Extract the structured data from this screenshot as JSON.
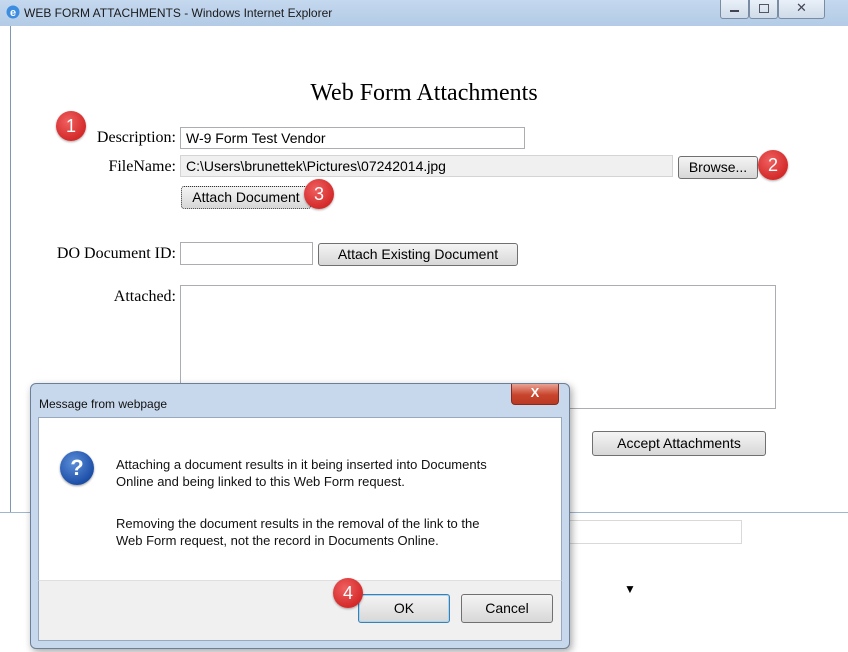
{
  "window": {
    "title": "WEB FORM ATTACHMENTS - Windows Internet Explorer"
  },
  "form": {
    "heading": "Web Form Attachments",
    "description_label": "Description:",
    "description_value": "W-9 Form Test Vendor",
    "filename_label": "FileName:",
    "filename_value": "C:\\Users\\brunettek\\Pictures\\07242014.jpg",
    "browse_label": "Browse...",
    "attach_document_label": "Attach Document",
    "do_document_id_label": "DO Document ID:",
    "do_document_id_value": "",
    "attach_existing_label": "Attach Existing Document",
    "attached_label": "Attached:",
    "accept_attachments_label": "Accept Attachments"
  },
  "callouts": [
    "1",
    "2",
    "3",
    "4"
  ],
  "dialog": {
    "title": "Message from webpage",
    "close_glyph": "X",
    "icon": "question-icon",
    "message_line1": "Attaching a document results in it being inserted into Documents",
    "message_line2": "Online and being linked to this Web Form request.",
    "message_line3": "Removing the document results in the removal of the link to the",
    "message_line4": "Web Form request, not the record in Documents Online.",
    "ok_label": "OK",
    "cancel_label": "Cancel"
  },
  "colors": {
    "callout_red": "#d42a2a",
    "title_bar": "#b3cbe6",
    "dialog_frame": "#c7d8ec"
  }
}
